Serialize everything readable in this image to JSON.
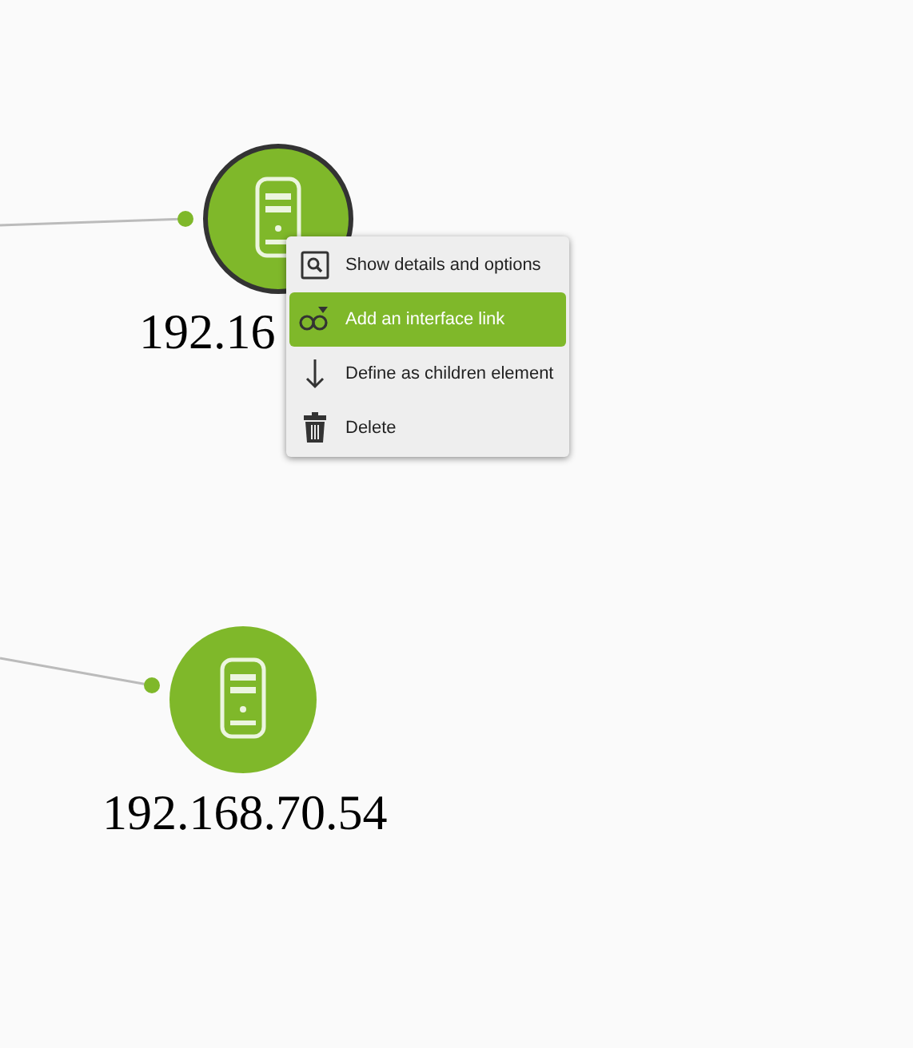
{
  "nodes": [
    {
      "label": "192.16",
      "selected": true
    },
    {
      "label": "192.168.70.54",
      "selected": false
    }
  ],
  "context_menu": {
    "items": [
      {
        "label": "Show details and options",
        "selected": false
      },
      {
        "label": "Add an interface link",
        "selected": true
      },
      {
        "label": "Define as children element",
        "selected": false
      },
      {
        "label": "Delete",
        "selected": false
      }
    ]
  }
}
